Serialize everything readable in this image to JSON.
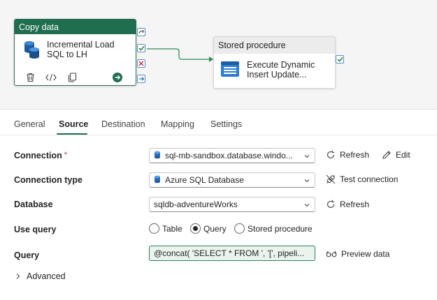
{
  "pipeline": {
    "copy_activity": {
      "type_label": "Copy data",
      "name_line1": "Incremental Load",
      "name_line2": "SQL to LH",
      "tool_icons": [
        "delete-icon",
        "code-icon",
        "copy-icon",
        "navigate-icon"
      ]
    },
    "ports": [
      "skip-port",
      "success-port",
      "fail-port",
      "completion-port"
    ],
    "sproc_activity": {
      "type_label": "Stored procedure",
      "name_line1": "Execute Dynamic",
      "name_line2": "Insert Update..."
    },
    "colors": {
      "accent": "#1f6e4f",
      "connector": "#2e8b57",
      "fail": "#c4314b",
      "port_border": "#5b8cc2"
    }
  },
  "tabs": [
    {
      "label": "General"
    },
    {
      "label": "Source",
      "active": true
    },
    {
      "label": "Destination"
    },
    {
      "label": "Mapping"
    },
    {
      "label": "Settings"
    }
  ],
  "form": {
    "connection": {
      "label": "Connection",
      "required_marker": "*",
      "value": "sql-mb-sandbox.database.windo...",
      "refresh_label": "Refresh",
      "edit_label": "Edit"
    },
    "connection_type": {
      "label": "Connection type",
      "value": "Azure SQL Database",
      "test_label": "Test connection"
    },
    "database": {
      "label": "Database",
      "value": "sqldb-adventureWorks",
      "refresh_label": "Refresh"
    },
    "use_query": {
      "label": "Use query",
      "options": [
        "Table",
        "Query",
        "Stored procedure"
      ],
      "selected": "Query"
    },
    "query": {
      "label": "Query",
      "value": "@concat( 'SELECT * FROM ', '[', pipeli...",
      "preview_label": "Preview data"
    },
    "advanced_label": "Advanced"
  }
}
